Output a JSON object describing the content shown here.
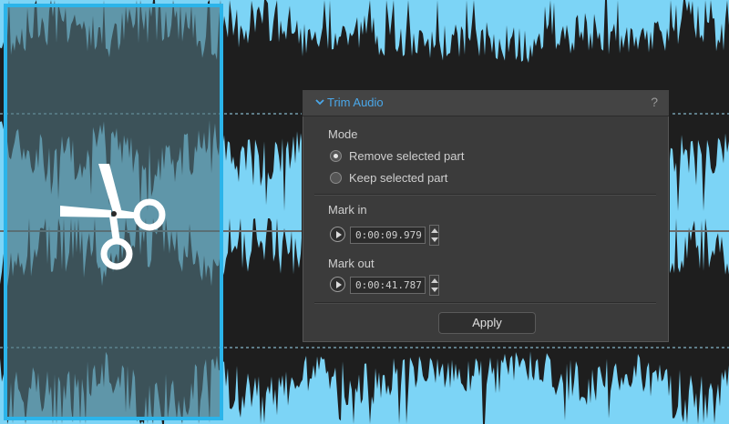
{
  "waveform": {
    "background_color": "#7cd4f6",
    "wave_color": "#1e1e1e",
    "selection_color": "#2bb4ea",
    "selection_fill": "#5f8f9e",
    "cut_icon": "scissors-icon"
  },
  "panel": {
    "title": "Trim Audio",
    "collapse_icon": "chevron-down-icon",
    "help_label": "?",
    "mode_label": "Mode",
    "options": [
      {
        "label": "Remove selected part",
        "selected": true
      },
      {
        "label": "Keep selected part",
        "selected": false
      }
    ],
    "mark_in": {
      "label": "Mark in",
      "value": "0:00:09.979"
    },
    "mark_out": {
      "label": "Mark out",
      "value": "0:00:41.787"
    },
    "apply_label": "Apply",
    "accent_color": "#4aa8ea"
  }
}
